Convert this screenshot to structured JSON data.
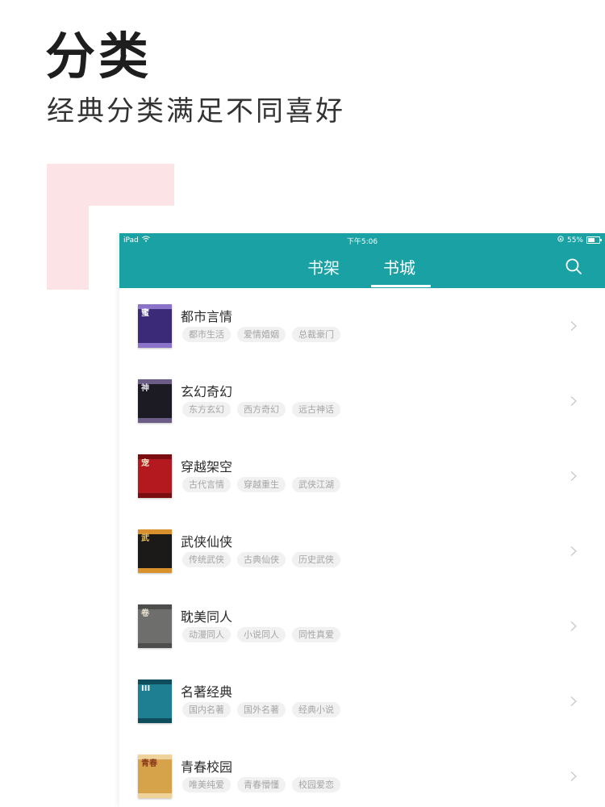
{
  "promo": {
    "title": "分类",
    "subtitle": "经典分类满足不同喜好",
    "accent_color": "#fce4e6"
  },
  "device": {
    "theme_color": "#1aa1a3",
    "status_bar": {
      "device_label": "iPad",
      "time": "下午5:06",
      "battery": "55%",
      "battery_level": 0.55,
      "wifi_icon": "wifi-icon",
      "orientation_lock_icon": "orientation-lock-icon"
    },
    "tabs": [
      {
        "label": "书架",
        "active": false
      },
      {
        "label": "书城",
        "active": true
      }
    ],
    "search_icon": "search-icon"
  },
  "categories": [
    {
      "name": "都市言情",
      "tags": [
        "都市生活",
        "爱情婚姻",
        "总裁豪门"
      ],
      "cover": {
        "bg": "#3b2a78",
        "accent": "#ffffff",
        "stripe": "#8a73c9",
        "title_text": "蜜"
      }
    },
    {
      "name": "玄幻奇幻",
      "tags": [
        "东方玄幻",
        "西方奇幻",
        "远古神话"
      ],
      "cover": {
        "bg": "#1c1a22",
        "accent": "#e6e1ef",
        "stripe": "#6c5d86",
        "title_text": "神"
      }
    },
    {
      "name": "穿越架空",
      "tags": [
        "古代言情",
        "穿越重生",
        "武侠江湖"
      ],
      "cover": {
        "bg": "#b3191f",
        "accent": "#f5e3c7",
        "stripe": "#7a0d10",
        "title_text": "宠"
      }
    },
    {
      "name": "武侠仙侠",
      "tags": [
        "传统武侠",
        "古典仙侠",
        "历史武侠"
      ],
      "cover": {
        "bg": "#1b1a18",
        "accent": "#e9c46a",
        "stripe": "#d9912e",
        "title_text": "武"
      }
    },
    {
      "name": "耽美同人",
      "tags": [
        "动漫同人",
        "小说同人",
        "同性真爱"
      ],
      "cover": {
        "bg": "#6e6f6c",
        "accent": "#e8e1cf",
        "stripe": "#4d4e4b",
        "title_text": "卷"
      }
    },
    {
      "name": "名著经典",
      "tags": [
        "国内名著",
        "国外名著",
        "经典小说"
      ],
      "cover": {
        "bg": "#1e7f92",
        "accent": "#f2f8fa",
        "stripe": "#0f4c5c",
        "title_text": "III"
      }
    },
    {
      "name": "青春校园",
      "tags": [
        "唯美纯爱",
        "青春懵懂",
        "校园爱恋"
      ],
      "cover": {
        "bg": "#d6a24a",
        "accent": "#8b3a1e",
        "stripe": "#efd39a",
        "title_text": "青春"
      }
    }
  ]
}
